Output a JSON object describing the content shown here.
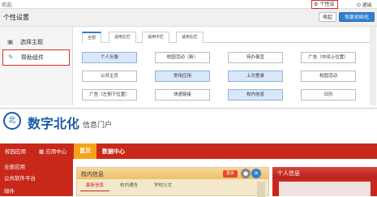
{
  "topbar": {
    "welcome": "欢迎,",
    "personalize_link": "个性设置",
    "logout": "退出"
  },
  "settings": {
    "title": "个性设置",
    "close_label": "收起",
    "restore_label": "恢复初始化",
    "sidebar": [
      {
        "label": "选择主题",
        "icon": "theme-icon"
      },
      {
        "label": "帮助组件",
        "icon": "wrench-icon"
      }
    ],
    "tabs": [
      "全部",
      "适用左栏",
      "适用中栏",
      "适用右栏"
    ],
    "components": [
      [
        "个人头像",
        "校园活动（新）",
        "待办事宜",
        "广告（中间上位置）"
      ],
      [
        "公共主页",
        "常用应用",
        "上次登录",
        "校园活动"
      ],
      [
        "广告（左侧下位置）",
        "快速链接",
        "校内信息",
        "日历"
      ]
    ]
  },
  "portal": {
    "logo_char": "北",
    "brand": "数字北化",
    "subtitle": "信息门户",
    "nav": {
      "campus_apps": "校园应用",
      "app_center": "应用中心",
      "home": "首页",
      "data_center": "数据中心"
    },
    "left_menu": [
      "全部应用",
      "公共软件平台",
      "邮件"
    ],
    "campus_info": {
      "title": "校内信息",
      "more": "更多",
      "tabs": [
        "最新信息",
        "校内通告",
        "学校公文"
      ]
    },
    "profile": {
      "title": "个人信息"
    }
  },
  "colors": {
    "accent_red": "#c8281a",
    "accent_blue": "#2f7fd2",
    "accent_orange": "#f6a21b",
    "highlight_border": "#d9302c"
  }
}
